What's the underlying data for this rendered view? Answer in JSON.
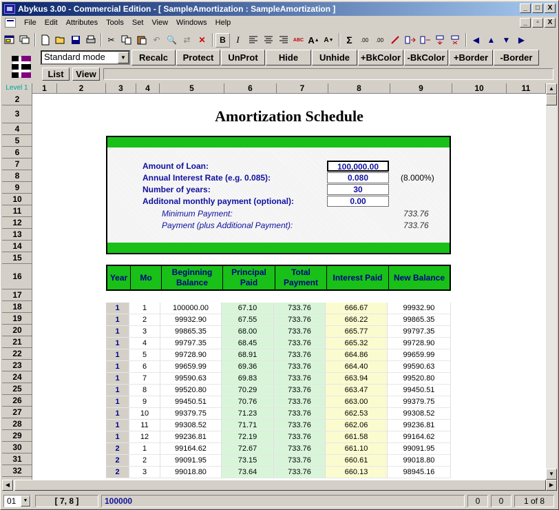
{
  "window": {
    "title": "Abykus 3.00  - Commercial Edition - [ SampleAmortization  :  SampleAmortization ]",
    "min": "_",
    "max": "□",
    "close": "X",
    "mdi_min": "_",
    "mdi_restore": "▫",
    "mdi_close": "X"
  },
  "menu": [
    "File",
    "Edit",
    "Attributes",
    "Tools",
    "Set",
    "View",
    "Windows",
    "Help"
  ],
  "toolbar": {
    "bold": "B",
    "italic": "I",
    "abc": "ABC",
    "sigma": "Σ",
    "dec1": ".00",
    "dec2": ".00"
  },
  "toolbar2": {
    "mode": "Standard mode",
    "buttons": [
      "Recalc",
      "Protect",
      "UnProt",
      "Hide",
      "Unhide",
      "+BkColor",
      "-BkColor",
      "+Border",
      "-Border"
    ]
  },
  "toolbar3": {
    "list": "List",
    "view": "View"
  },
  "columns": [
    "Level 1",
    "1",
    "2",
    "3",
    "4",
    "5",
    "6",
    "7",
    "8",
    "9",
    "10",
    "11"
  ],
  "rows": [
    "2",
    "3",
    "4",
    "5",
    "6",
    "7",
    "8",
    "9",
    "10",
    "11",
    "12",
    "13",
    "14",
    "15",
    "16",
    "17",
    "18",
    "19",
    "20",
    "21",
    "22",
    "23",
    "24",
    "25",
    "26",
    "27",
    "28",
    "29",
    "30",
    "31",
    "32"
  ],
  "sheet": {
    "title": "Amortization Schedule",
    "inputs": [
      {
        "label": "Amount of Loan:",
        "value": "100,000.00",
        "extra": ""
      },
      {
        "label": "Annual Interest Rate (e.g. 0.085):",
        "value": "0.080",
        "extra": "(8.000%)"
      },
      {
        "label": "Number of years:",
        "value": "30",
        "extra": ""
      },
      {
        "label": "Additonal monthly payment (optional):",
        "value": "0.00",
        "extra": ""
      }
    ],
    "min_payment_label": "Minimum Payment:",
    "min_payment_value": "733.76",
    "payment_label": "Payment (plus Additional Payment):",
    "payment_value": "733.76",
    "table_headers": [
      "Year",
      "Mo",
      "Beginning Balance",
      "Principal Paid",
      "Total Payment",
      "Interest Paid",
      "New Balance"
    ],
    "table_rows": [
      [
        "1",
        "1",
        "100000.00",
        "67.10",
        "733.76",
        "666.67",
        "99932.90"
      ],
      [
        "1",
        "2",
        "99932.90",
        "67.55",
        "733.76",
        "666.22",
        "99865.35"
      ],
      [
        "1",
        "3",
        "99865.35",
        "68.00",
        "733.76",
        "665.77",
        "99797.35"
      ],
      [
        "1",
        "4",
        "99797.35",
        "68.45",
        "733.76",
        "665.32",
        "99728.90"
      ],
      [
        "1",
        "5",
        "99728.90",
        "68.91",
        "733.76",
        "664.86",
        "99659.99"
      ],
      [
        "1",
        "6",
        "99659.99",
        "69.36",
        "733.76",
        "664.40",
        "99590.63"
      ],
      [
        "1",
        "7",
        "99590.63",
        "69.83",
        "733.76",
        "663.94",
        "99520.80"
      ],
      [
        "1",
        "8",
        "99520.80",
        "70.29",
        "733.76",
        "663.47",
        "99450.51"
      ],
      [
        "1",
        "9",
        "99450.51",
        "70.76",
        "733.76",
        "663.00",
        "99379.75"
      ],
      [
        "1",
        "10",
        "99379.75",
        "71.23",
        "733.76",
        "662.53",
        "99308.52"
      ],
      [
        "1",
        "11",
        "99308.52",
        "71.71",
        "733.76",
        "662.06",
        "99236.81"
      ],
      [
        "1",
        "12",
        "99236.81",
        "72.19",
        "733.76",
        "661.58",
        "99164.62"
      ],
      [
        "2",
        "1",
        "99164.62",
        "72.67",
        "733.76",
        "661.10",
        "99091.95"
      ],
      [
        "2",
        "2",
        "99091.95",
        "73.15",
        "733.76",
        "660.61",
        "99018.80"
      ],
      [
        "2",
        "3",
        "99018.80",
        "73.64",
        "733.76",
        "660.13",
        "98945.16"
      ]
    ]
  },
  "status": {
    "sheet": "01",
    "cell": "[ 7, 8 ]",
    "content": "100000",
    "c1": "0",
    "c2": "0",
    "page": "1 of 8"
  }
}
